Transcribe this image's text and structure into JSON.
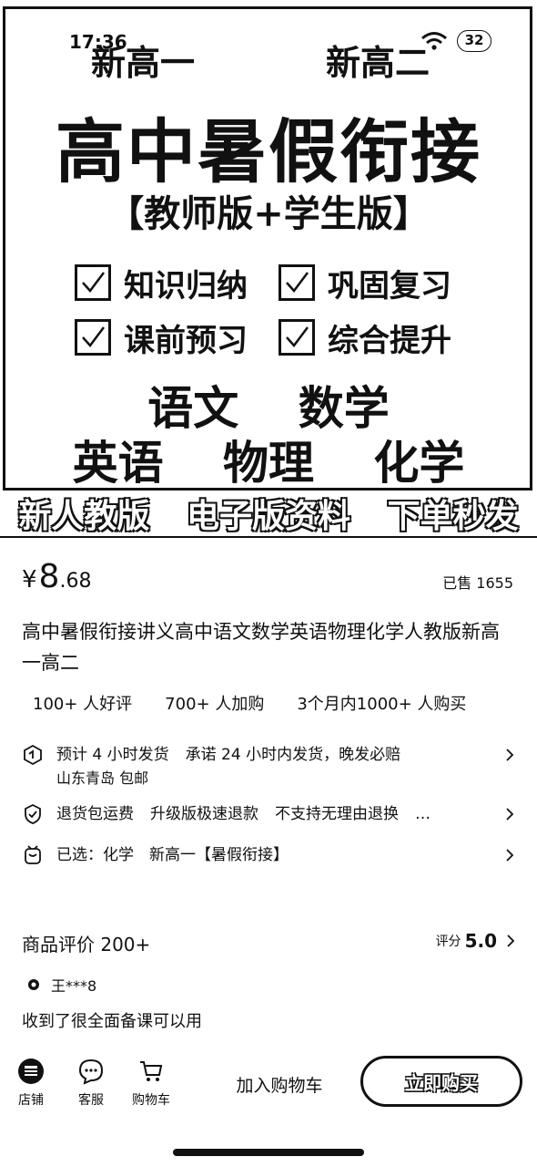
{
  "status_bar": {
    "time": "17:36",
    "battery": "32"
  },
  "hero": {
    "grade_left": "新高一",
    "grade_right": "新高二",
    "title": "高中暑假衔接",
    "edition": "【教师版+学生版】",
    "features": [
      "知识归纳",
      "巩固复习",
      "课前预习",
      "综合提升"
    ],
    "subjects_row1": [
      "语文",
      "数学"
    ],
    "subjects_row2": [
      "英语",
      "物理",
      "化学"
    ],
    "banner": [
      "新人教版",
      "电子版资料",
      "下单秒发"
    ]
  },
  "price": {
    "symbol": "¥",
    "integer": "8",
    "decimal": ".68"
  },
  "sold": "已售 1655",
  "product_title": "高中暑假衔接讲义高中语文数学英语物理化学人教版新高一高二",
  "tags": [
    "100+ 人好评",
    "700+ 人加购",
    "3个月内1000+ 人购买"
  ],
  "shipping": {
    "parts": [
      "预计 4 小时发货",
      "承诺 24 小时内发货，晚发必赔"
    ],
    "location": "山东青岛 包邮"
  },
  "returns": {
    "parts": [
      "退货包运费",
      "升级版极速退款",
      "不支持无理由退换",
      "…"
    ]
  },
  "selected": {
    "label": "已选：",
    "value": "化学　新高一【暑假衔接】"
  },
  "reviews": {
    "title": "商品评价 200+",
    "score_label": "评分",
    "score": "5.0",
    "reviewer": "王***8",
    "text": "收到了很全面备课可以用"
  },
  "bottom_bar": {
    "store": "店铺",
    "service": "客服",
    "cart": "购物车",
    "add_to_cart": "加入购物车",
    "buy_now": "立即购买"
  }
}
